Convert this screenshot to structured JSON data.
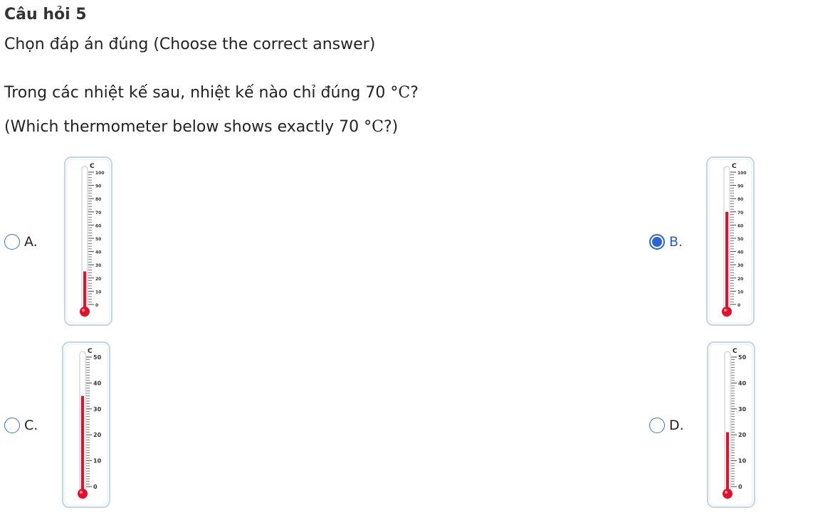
{
  "question": {
    "title": "Câu hỏi 5",
    "instruction": "Chọn đáp án đúng (Choose the correct answer)",
    "text_vi_pre": "Trong các nhiệt kế sau, nhiệt kế nào chỉ đúng 70 ",
    "text_vi_unit": "°C",
    "text_vi_post": "?",
    "text_en_pre": "(Which thermometer below shows exactly 70 ",
    "text_en_unit": "°C",
    "text_en_post": "?)"
  },
  "colors": {
    "accent": "#2a63d8",
    "mercury": "#e2102a",
    "thermo_border": "#c3d6e2"
  },
  "options": [
    {
      "label": "A.",
      "selected": false,
      "thermometer": {
        "unit": "C",
        "ticks": [
          "100",
          "90",
          "80",
          "70",
          "60",
          "50",
          "40",
          "30",
          "20",
          "10",
          "0"
        ],
        "min": 0,
        "max": 100,
        "reading": 25
      }
    },
    {
      "label": "B.",
      "selected": true,
      "thermometer": {
        "unit": "C",
        "ticks": [
          "100",
          "90",
          "80",
          "70",
          "60",
          "50",
          "40",
          "30",
          "20",
          "10",
          "0"
        ],
        "min": 0,
        "max": 100,
        "reading": 70
      }
    },
    {
      "label": "C.",
      "selected": false,
      "thermometer": {
        "unit": "C",
        "ticks": [
          "50",
          "40",
          "30",
          "20",
          "10",
          "0"
        ],
        "min": 0,
        "max": 50,
        "reading": 35
      }
    },
    {
      "label": "D.",
      "selected": false,
      "thermometer": {
        "unit": "C",
        "ticks": [
          "50",
          "40",
          "30",
          "20",
          "10",
          "0"
        ],
        "min": 0,
        "max": 50,
        "reading": 21
      }
    }
  ]
}
